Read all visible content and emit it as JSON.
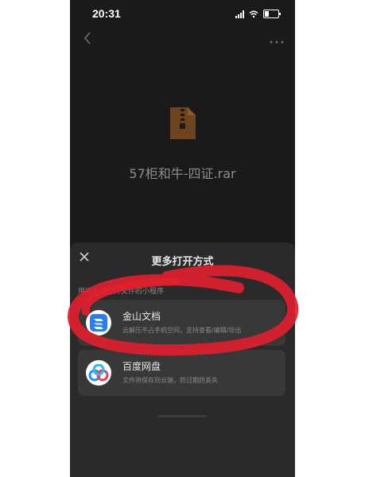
{
  "status": {
    "time": "20:31"
  },
  "file": {
    "name": "57柜和牛-四证.rar"
  },
  "sheet": {
    "title": "更多打开方式",
    "section_label": "用适合的打开文件的小程序",
    "options": [
      {
        "name": "金山文档",
        "desc": "云解压不占手机空间，支持查看/编辑/导出",
        "icon": "kingsoft-docs-icon"
      },
      {
        "name": "百度网盘",
        "desc": "文件将保存到云端，防过期防丢失",
        "icon": "baidu-netdisk-icon"
      }
    ]
  },
  "colors": {
    "background": "#1a1a1a",
    "sheet": "#2a2a2a",
    "option_bg": "#383838",
    "annotation": "#e0202e",
    "file_icon": "#7a4a1e"
  }
}
